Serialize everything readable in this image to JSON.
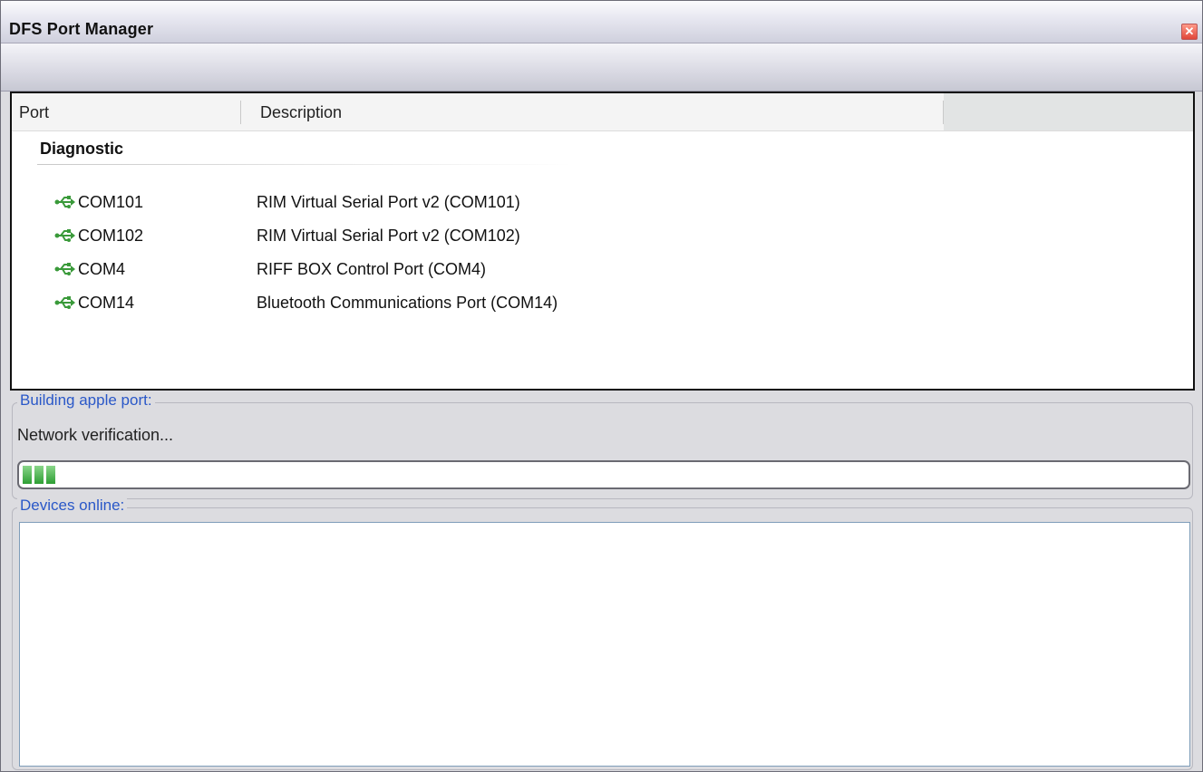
{
  "window": {
    "title": "DFS Port Manager"
  },
  "list": {
    "columns": [
      "Port",
      "Description"
    ],
    "group": "Diagnostic",
    "rows": [
      {
        "port": "COM101",
        "description": "RIM Virtual Serial Port v2 (COM101)",
        "icon": "usb-icon"
      },
      {
        "port": "COM102",
        "description": "RIM Virtual Serial Port v2 (COM102)",
        "icon": "usb-icon"
      },
      {
        "port": "COM4",
        "description": "RIFF BOX Control Port (COM4)",
        "icon": "usb-icon"
      },
      {
        "port": "COM14",
        "description": "Bluetooth Communications Port (COM14)",
        "icon": "usb-icon"
      }
    ]
  },
  "build": {
    "legend": "Building apple port:",
    "status": "Network verification...",
    "progress": 0.03
  },
  "devices": {
    "legend": "Devices online:"
  },
  "colors": {
    "accent_legend": "#2a58c8",
    "progress_green": "#2e9e34",
    "close_red": "#e0463a"
  }
}
